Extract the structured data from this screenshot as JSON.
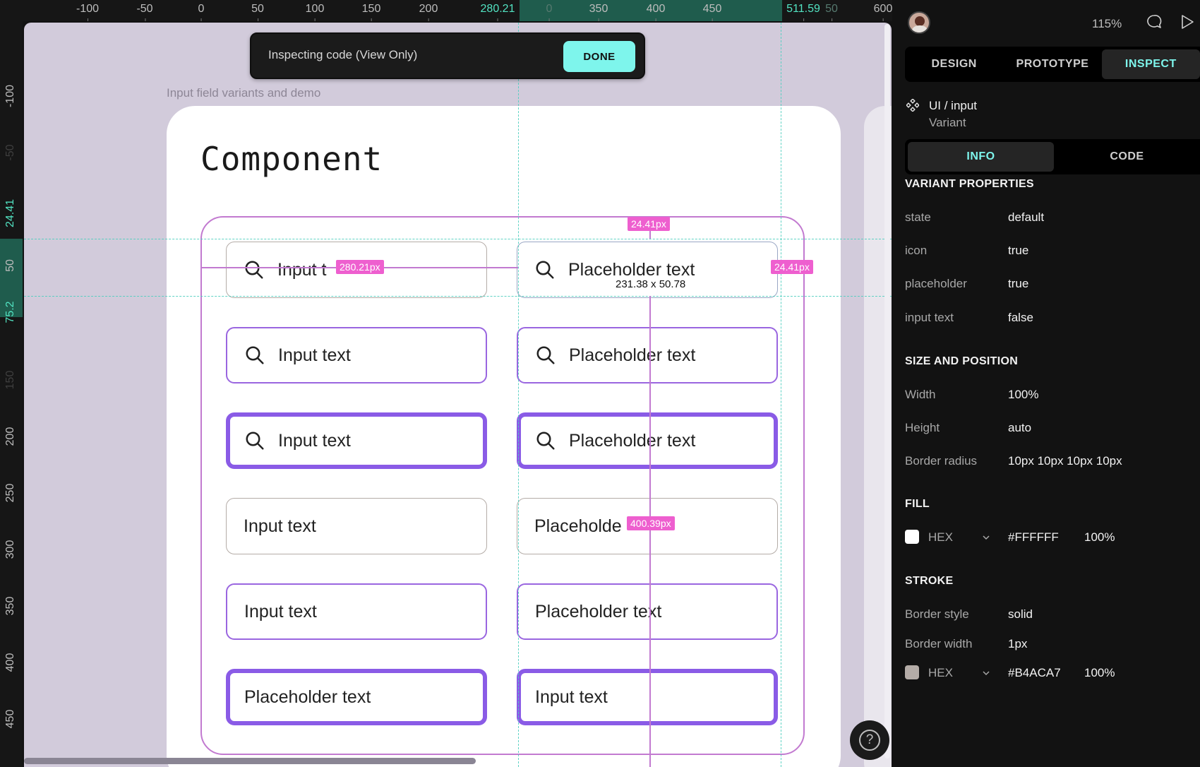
{
  "ruler": {
    "top_ticks": [
      "-100",
      "-50",
      "0",
      "50",
      "100",
      "150",
      "200",
      "280.21",
      "0",
      "350",
      "400",
      "450",
      "511.59",
      "50",
      "600"
    ],
    "left_ticks": [
      "-100",
      "-50",
      "24.41",
      "50",
      "75.2",
      "150",
      "200",
      "250",
      "300",
      "350",
      "400",
      "450"
    ]
  },
  "toast": {
    "text": "Inspecting code (View Only)",
    "done_label": "DONE"
  },
  "canvas": {
    "frame_label": "Input field variants and demo",
    "board_title": "Component",
    "fields": [
      {
        "text": "Input t"
      },
      {
        "text": "Placeholder text"
      },
      {
        "text": "Input text"
      },
      {
        "text": "Placeholder text"
      },
      {
        "text": "Input text"
      },
      {
        "text": "Placeholder text"
      },
      {
        "text": "Input text"
      },
      {
        "text": "Placeholde"
      },
      {
        "text": "Input text"
      },
      {
        "text": "Placeholder text"
      },
      {
        "text": "Placeholder text"
      },
      {
        "text": "Input text"
      }
    ],
    "measure": {
      "top_gap": "24.41px",
      "right_gap": "24.41px",
      "left_distance": "280.21px",
      "bottom_distance": "400.39px",
      "selection_size": "231.38 x 50.78"
    }
  },
  "panel": {
    "zoom": "115%",
    "tabs": [
      "DESIGN",
      "PROTOTYPE",
      "INSPECT"
    ],
    "component_name": "UI / input",
    "component_sub": "Variant",
    "subtabs": [
      "INFO",
      "CODE"
    ],
    "variant_title": "VARIANT PROPERTIES",
    "variant_props": [
      {
        "k": "state",
        "v": "default"
      },
      {
        "k": "icon",
        "v": "true"
      },
      {
        "k": "placeholder",
        "v": "true"
      },
      {
        "k": "input text",
        "v": "false"
      }
    ],
    "size_title": "SIZE AND POSITION",
    "size_props": [
      {
        "k": "Width",
        "v": "100%"
      },
      {
        "k": "Height",
        "v": "auto"
      },
      {
        "k": "Border radius",
        "v": "10px 10px 10px 10px"
      }
    ],
    "fill_title": "FILL",
    "fill": {
      "mode": "HEX",
      "value": "#FFFFFF",
      "opacity": "100%",
      "color": "#FFFFFF"
    },
    "stroke_title": "STROKE",
    "stroke_props": [
      {
        "k": "Border style",
        "v": "solid"
      },
      {
        "k": "Border width",
        "v": "1px"
      }
    ],
    "stroke": {
      "mode": "HEX",
      "value": "#B4ACA7",
      "opacity": "100%",
      "color": "#B4ACA7"
    }
  }
}
